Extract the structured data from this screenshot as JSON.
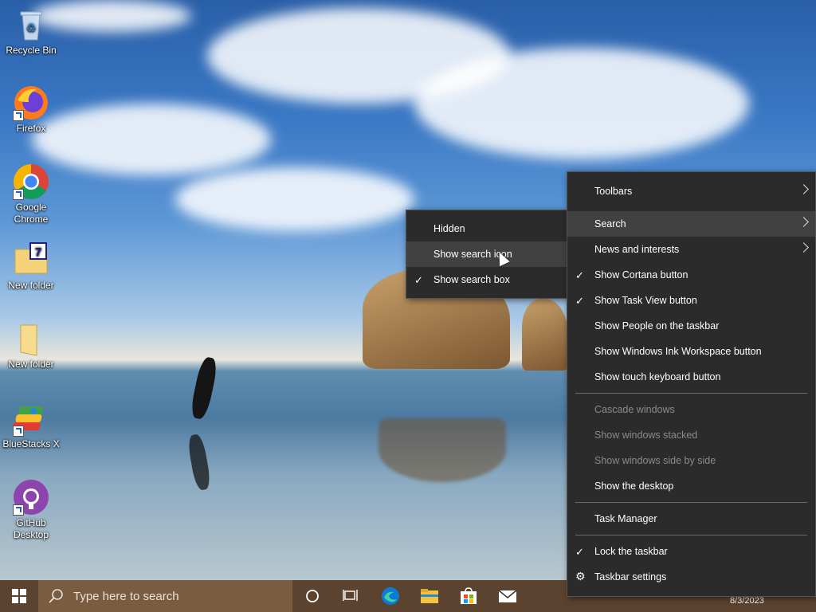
{
  "desktop": {
    "icons": [
      {
        "label": "Recycle Bin",
        "icon": "recycle-bin-icon"
      },
      {
        "label": "Firefox",
        "icon": "firefox-icon"
      },
      {
        "label": "Google Chrome",
        "icon": "chrome-icon"
      },
      {
        "label": "New folder",
        "icon": "folder-icon"
      },
      {
        "label": "New folder",
        "icon": "folder-icon"
      },
      {
        "label": "BlueStacks X",
        "icon": "bluestacks-icon"
      },
      {
        "label": "GitHub Desktop",
        "icon": "github-desktop-icon"
      }
    ]
  },
  "taskbar": {
    "search_placeholder": "Type here to search",
    "date": "8/3/2023",
    "apps": [
      "cortana-icon",
      "task-view-icon",
      "edge-icon",
      "file-explorer-icon",
      "store-icon",
      "mail-icon"
    ]
  },
  "submenu": {
    "items": [
      {
        "label": "Hidden",
        "checked": false
      },
      {
        "label": "Show search icon",
        "checked": false,
        "highlighted": true
      },
      {
        "label": "Show search box",
        "checked": true
      }
    ]
  },
  "context_menu": {
    "items": [
      {
        "label": "Toolbars",
        "submenu": true
      },
      {
        "label": "Search",
        "submenu": true,
        "highlighted": true
      },
      {
        "label": "News and interests",
        "submenu": true
      },
      {
        "label": "Show Cortana button",
        "checked": true
      },
      {
        "label": "Show Task View button",
        "checked": true
      },
      {
        "label": "Show People on the taskbar"
      },
      {
        "label": "Show Windows Ink Workspace button"
      },
      {
        "label": "Show touch keyboard button"
      },
      {
        "label": "Cascade windows",
        "disabled": true
      },
      {
        "label": "Show windows stacked",
        "disabled": true
      },
      {
        "label": "Show windows side by side",
        "disabled": true
      },
      {
        "label": "Show the desktop"
      },
      {
        "label": "Task Manager"
      },
      {
        "label": "Lock the taskbar",
        "checked": true
      },
      {
        "label": "Taskbar settings",
        "icon": "gear-icon"
      }
    ]
  },
  "colors": {
    "taskbar": "#5b4330",
    "search_box": "#7a5c40",
    "menu_bg": "#2b2b2b",
    "menu_highlight": "#414141"
  }
}
